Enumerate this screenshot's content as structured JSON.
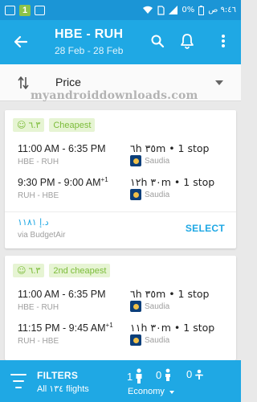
{
  "status_bar": {
    "badge": "1",
    "battery": "0%",
    "time": "٩:٤٦ ص"
  },
  "header": {
    "title": "HBE - RUH",
    "dates": "28 Feb - 28 Feb",
    "icons": [
      "back-arrow-icon",
      "search-icon",
      "bell-icon",
      "more-vert-icon"
    ]
  },
  "sort": {
    "label": "Price"
  },
  "watermark": "myandroiddownloads.com",
  "results": [
    {
      "badge_score": "٦.٣",
      "badge_label": "Cheapest",
      "legs": [
        {
          "time": "11:00 AM - 6:35 PM",
          "plus": "",
          "route": "HBE - RUH",
          "duration": "٦h ٣٥m • 1 stop",
          "airline": "Saudia"
        },
        {
          "time": "9:30 PM - 9:00 AM",
          "plus": "+1",
          "route": "RUH - HBE",
          "duration": "١٢h ٣٠m • 1 stop",
          "airline": "Saudia"
        }
      ],
      "price": "د.إ ١١٨١",
      "provider": "via BudgetAir",
      "action": "SELECT"
    },
    {
      "badge_score": "٦.٣",
      "badge_label": "2nd cheapest",
      "legs": [
        {
          "time": "11:00 AM - 6:35 PM",
          "plus": "",
          "route": "HBE - RUH",
          "duration": "٦h ٣٥m • 1 stop",
          "airline": "Saudia"
        },
        {
          "time": "11:15 PM - 9:45 AM",
          "plus": "+1",
          "route": "RUH - HBE",
          "duration": "١١h ٣٠m • 1 stop",
          "airline": "Saudia"
        }
      ]
    }
  ],
  "bottom_bar": {
    "filters_label": "FILTERS",
    "flights_label": "All ١٣٤ flights",
    "adults": "1",
    "children": "0",
    "infants": "0",
    "cabin": "Economy"
  },
  "colors": {
    "status_bar": "#1b95d6",
    "primary": "#1fa8e4",
    "badge_bg": "#e6f4d3",
    "badge_text": "#7cbc3a"
  }
}
